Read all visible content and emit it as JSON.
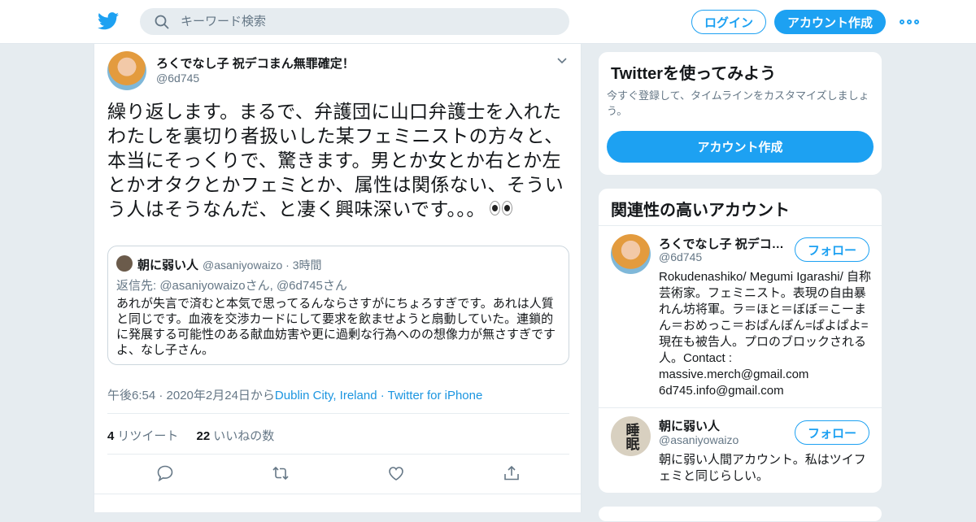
{
  "header": {
    "search_placeholder": "キーワード検索",
    "login_label": "ログイン",
    "signup_label": "アカウント作成"
  },
  "tweet": {
    "author_name": "ろくでなし子 祝デコまん無罪確定！",
    "author_handle": "@6d745",
    "text": "繰り返します。まるで、弁護団に山口弁護士を入れたわたしを裏切り者扱いした某フェミニストの方々と、本当にそっくりで、驚きます。男とか女とか右とか左とかオタクとかフェミとか、属性は関係ない、そういう人はそうなんだ、と凄く興味深いです。。。",
    "quote": {
      "name": "朝に弱い人",
      "handle": "@asaniyowaizo",
      "time": "· 3時間",
      "reply_to": "返信先: @asaniyowaizoさん, @6d745さん",
      "text": "あれが失言で済むと本気で思ってるんならさすがにちょろすぎです。あれは人質と同じです。血液を交渉カードにして要求を飲ませようと扇動していた。連鎖的に発展する可能性のある献血妨害や更に過剰な行為へのの想像力が無さすぎですよ、なし子さん。"
    },
    "timestamp": "午後6:54 · 2020年2月24日から",
    "location": "Dublin City, Ireland",
    "dot": " · ",
    "source": "Twitter for iPhone",
    "retweets_count": "4",
    "retweets_label": "リツイート",
    "likes_count": "22",
    "likes_label": "いいねの数"
  },
  "sidebar": {
    "try": {
      "title": "Twitterを使ってみよう",
      "description": "今すぐ登録して、タイムラインをカスタマイズしましょう。",
      "button": "アカウント作成"
    },
    "related": {
      "title": "関連性の高いアカウント",
      "follow_label": "フォロー",
      "accounts": [
        {
          "name": "ろくでなし子 祝デコまん無罪確定！",
          "handle": "@6d745",
          "bio": "Rokudenashiko/ Megumi Igarashi/ 自称芸術家。フェミニスト。表現の自由暴れん坊将軍。ラ＝ほと＝ぼぼ＝こーまん＝おめっこ＝おぱんぽん=ぱよぱよ=現在も被告人。プロのブロックされる人。Contact : massive.merch@gmail.com 6d745.info@gmail.com"
        },
        {
          "name": "朝に弱い人",
          "handle": "@asaniyowaizo",
          "bio": "朝に弱い人間アカウント。私はツイフェミと同じらしい。",
          "avatar_text": "睡眠"
        }
      ]
    }
  },
  "colors": {
    "accent": "#1da1f2",
    "link": "#1b95e0",
    "muted": "#657786"
  }
}
